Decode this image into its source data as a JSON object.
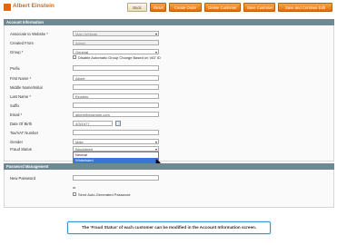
{
  "header": {
    "title": "Albert Einstein",
    "buttons": {
      "back": "Back",
      "reset": "Reset",
      "create_order": "Create Order",
      "delete": "Delete Customer",
      "save": "Save Customer",
      "save_continue": "Save and Continue Edit"
    }
  },
  "sections": {
    "account": "Account Information",
    "password": "Password Management"
  },
  "account": {
    "associate_label": "Associate to Website *",
    "associate_value": "Main Website",
    "created_from_label": "Created From",
    "created_from_value": "Admin",
    "group_label": "Group *",
    "group_value": "General",
    "disable_group_change": "Disable Automatic Group Change Based on VAT ID",
    "prefix_label": "Prefix",
    "first_name_label": "First Name *",
    "first_name_value": "Albert",
    "middle_name_label": "Middle Name/Initial",
    "last_name_label": "Last Name *",
    "last_name_value": "Einstein",
    "suffix_label": "Suffix",
    "email_label": "Email *",
    "email_value": "albert@example.com",
    "dob_label": "Date Of Birth",
    "dob_value": "4/3/1977",
    "taxvat_label": "Tax/VAT Number",
    "gender_label": "Gender",
    "gender_value": "Male",
    "fraud_label": "Fraud Status",
    "fraud_value": "Blacklisted",
    "fraud_options": [
      "Neutral",
      "Whitelisted",
      "Blacklisted"
    ],
    "fraud_selected_index": 1
  },
  "password": {
    "new_password_label": "New Password",
    "or_text": "or",
    "send_auto_generated": "Send Auto-Generated Password"
  },
  "caption": "The 'Fraud Status' of each customer can be modified in the Account Information screen.",
  "colors": {
    "accent": "#e26703",
    "section_header": "#6f8992",
    "selected_option": "#3875d7",
    "caption_border": "#2f9bd1"
  }
}
